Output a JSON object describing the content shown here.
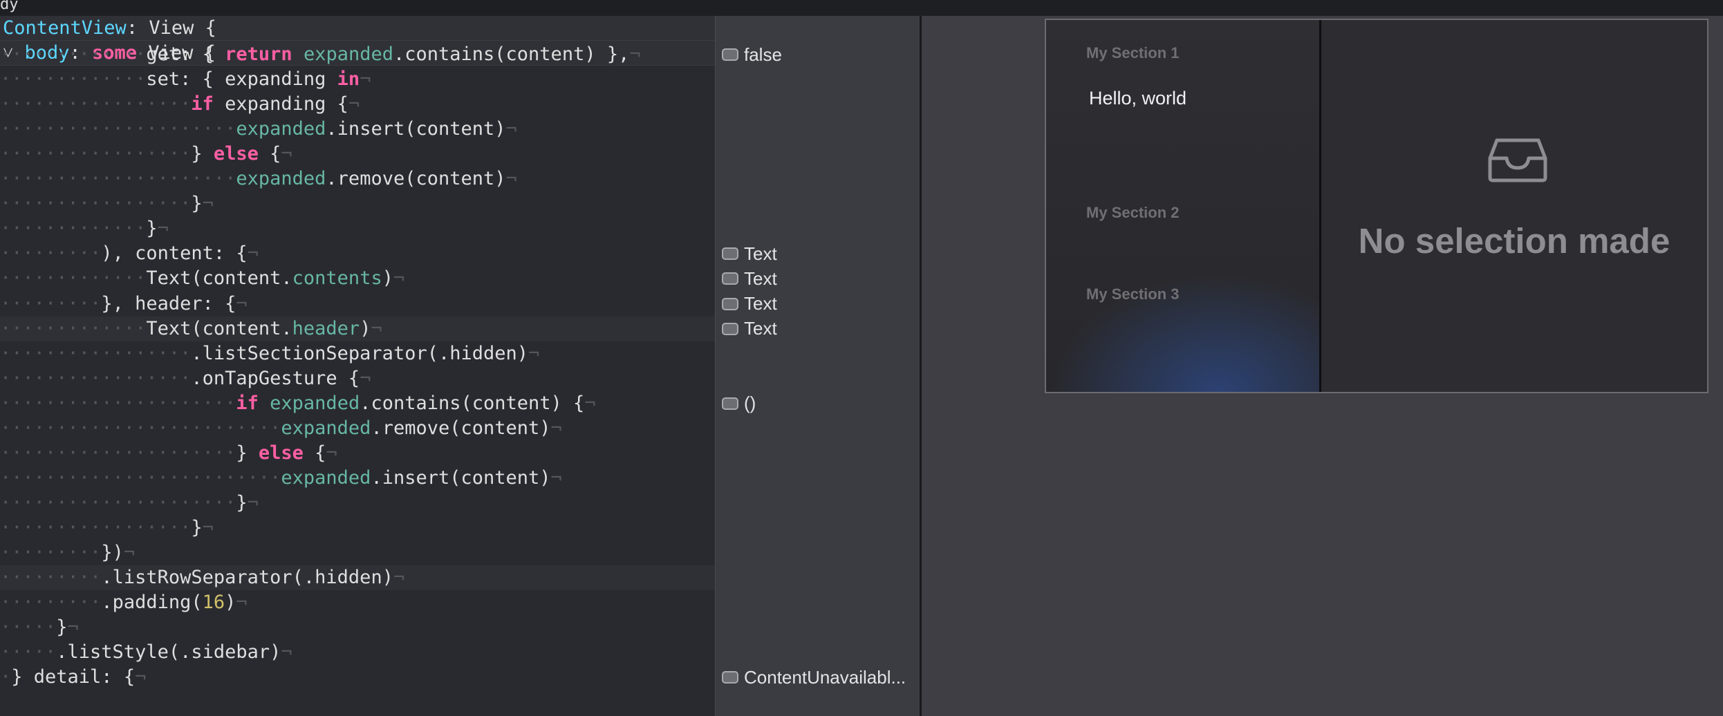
{
  "topbar": {
    "text": "dy"
  },
  "sticky": [
    {
      "t": "tp",
      "v": "ContentView"
    },
    {
      "t": "",
      "v": ": View {"
    }
  ],
  "sticky2": [
    {
      "t": "",
      "v": "˅ "
    },
    {
      "t": "tp",
      "v": "body"
    },
    {
      "t": "",
      "v": ": "
    },
    {
      "t": "kw",
      "v": "some"
    },
    {
      "t": "",
      "v": " View {"
    }
  ],
  "code_lines": [
    [
      {
        "t": "ws",
        "v": "·············"
      },
      {
        "t": "",
        "v": "get: { "
      },
      {
        "t": "kw",
        "v": "return"
      },
      {
        "t": "",
        "v": " "
      },
      {
        "t": "pr",
        "v": "expanded"
      },
      {
        "t": "",
        "v": ".contains(content) },"
      },
      {
        "t": "eol",
        "v": "¬"
      }
    ],
    [
      {
        "t": "ws",
        "v": "·············"
      },
      {
        "t": "",
        "v": "set: { expanding "
      },
      {
        "t": "kw",
        "v": "in"
      },
      {
        "t": "eol",
        "v": "¬"
      }
    ],
    [
      {
        "t": "ws",
        "v": "·················"
      },
      {
        "t": "kw",
        "v": "if"
      },
      {
        "t": "",
        "v": " expanding {"
      },
      {
        "t": "eol",
        "v": "¬"
      }
    ],
    [
      {
        "t": "ws",
        "v": "·····················"
      },
      {
        "t": "pr",
        "v": "expanded"
      },
      {
        "t": "",
        "v": ".insert(content)"
      },
      {
        "t": "eol",
        "v": "¬"
      }
    ],
    [
      {
        "t": "ws",
        "v": "·················"
      },
      {
        "t": "",
        "v": "} "
      },
      {
        "t": "kw",
        "v": "else"
      },
      {
        "t": "",
        "v": " {"
      },
      {
        "t": "eol",
        "v": "¬"
      }
    ],
    [
      {
        "t": "ws",
        "v": "·····················"
      },
      {
        "t": "pr",
        "v": "expanded"
      },
      {
        "t": "",
        "v": ".remove(content)"
      },
      {
        "t": "eol",
        "v": "¬"
      }
    ],
    [
      {
        "t": "ws",
        "v": "·················"
      },
      {
        "t": "",
        "v": "}"
      },
      {
        "t": "eol",
        "v": "¬"
      }
    ],
    [
      {
        "t": "ws",
        "v": "·············"
      },
      {
        "t": "",
        "v": "}"
      },
      {
        "t": "eol",
        "v": "¬"
      }
    ],
    [
      {
        "t": "ws",
        "v": "·········"
      },
      {
        "t": "",
        "v": "), content: {"
      },
      {
        "t": "eol",
        "v": "¬"
      }
    ],
    [
      {
        "t": "ws",
        "v": "·············"
      },
      {
        "t": "",
        "v": "Text(content."
      },
      {
        "t": "pr",
        "v": "contents"
      },
      {
        "t": "",
        "v": ")"
      },
      {
        "t": "eol",
        "v": "¬"
      }
    ],
    [
      {
        "t": "ws",
        "v": "·········"
      },
      {
        "t": "",
        "v": "}, header: {"
      },
      {
        "t": "eol",
        "v": "¬"
      }
    ],
    [
      {
        "t": "ws",
        "v": "·············"
      },
      {
        "t": "",
        "v": "Text(content."
      },
      {
        "t": "pr",
        "v": "header"
      },
      {
        "t": "",
        "v": ")"
      },
      {
        "t": "eol",
        "v": "¬"
      }
    ],
    [
      {
        "t": "ws",
        "v": "·················"
      },
      {
        "t": "",
        "v": ".listSectionSeparator(.hidden)"
      },
      {
        "t": "eol",
        "v": "¬"
      }
    ],
    [
      {
        "t": "ws",
        "v": "·················"
      },
      {
        "t": "",
        "v": ".onTapGesture {"
      },
      {
        "t": "eol",
        "v": "¬"
      }
    ],
    [
      {
        "t": "ws",
        "v": "·····················"
      },
      {
        "t": "kw",
        "v": "if"
      },
      {
        "t": "",
        "v": " "
      },
      {
        "t": "pr",
        "v": "expanded"
      },
      {
        "t": "",
        "v": ".contains(content) {"
      },
      {
        "t": "eol",
        "v": "¬"
      }
    ],
    [
      {
        "t": "ws",
        "v": "·························"
      },
      {
        "t": "pr",
        "v": "expanded"
      },
      {
        "t": "",
        "v": ".remove(content)"
      },
      {
        "t": "eol",
        "v": "¬"
      }
    ],
    [
      {
        "t": "ws",
        "v": "·····················"
      },
      {
        "t": "",
        "v": "} "
      },
      {
        "t": "kw",
        "v": "else"
      },
      {
        "t": "",
        "v": " {"
      },
      {
        "t": "eol",
        "v": "¬"
      }
    ],
    [
      {
        "t": "ws",
        "v": "·························"
      },
      {
        "t": "pr",
        "v": "expanded"
      },
      {
        "t": "",
        "v": ".insert(content)"
      },
      {
        "t": "eol",
        "v": "¬"
      }
    ],
    [
      {
        "t": "ws",
        "v": "·····················"
      },
      {
        "t": "",
        "v": "}"
      },
      {
        "t": "eol",
        "v": "¬"
      }
    ],
    [
      {
        "t": "ws",
        "v": "·················"
      },
      {
        "t": "",
        "v": "}"
      },
      {
        "t": "eol",
        "v": "¬"
      }
    ],
    [
      {
        "t": "ws",
        "v": "·········"
      },
      {
        "t": "",
        "v": "})"
      },
      {
        "t": "eol",
        "v": "¬"
      }
    ],
    [
      {
        "t": "ws",
        "v": "·········"
      },
      {
        "t": "",
        "v": ".listRowSeparator(.hidden)"
      },
      {
        "t": "eol",
        "v": "¬"
      }
    ],
    [
      {
        "t": "ws",
        "v": "·········"
      },
      {
        "t": "",
        "v": ".padding("
      },
      {
        "t": "nm",
        "v": "16"
      },
      {
        "t": "",
        "v": ")"
      },
      {
        "t": "eol",
        "v": "¬"
      }
    ],
    [
      {
        "t": "ws",
        "v": "·····"
      },
      {
        "t": "",
        "v": "}"
      },
      {
        "t": "eol",
        "v": "¬"
      }
    ],
    [
      {
        "t": "ws",
        "v": "·····"
      },
      {
        "t": "",
        "v": ".listStyle(.sidebar)"
      },
      {
        "t": "eol",
        "v": "¬"
      }
    ],
    [
      {
        "t": "ws",
        "v": "·"
      },
      {
        "t": "",
        "v": "} detail: {"
      },
      {
        "t": "eol",
        "v": "¬"
      }
    ]
  ],
  "highlighted_lines": [
    11,
    21
  ],
  "results": [
    {
      "line": 0,
      "label": "false"
    },
    {
      "line": 8,
      "label": "Text"
    },
    {
      "line": 9,
      "label": "Text"
    },
    {
      "line": 10,
      "label": "Text"
    },
    {
      "line": 11,
      "label": "Text"
    },
    {
      "line": 14,
      "label": "()"
    },
    {
      "line": 25,
      "label": "ContentUnavailabl..."
    }
  ],
  "preview": {
    "sections": [
      "My Section 1",
      "My Section 2",
      "My Section 3"
    ],
    "row_text": "Hello, world",
    "empty_title": "No selection made",
    "icon": "tray-icon"
  },
  "colors": {
    "keyword": "#fc5fa3",
    "type": "#5dd8ff",
    "property": "#67b7a4",
    "number": "#d0bf69",
    "editor_bg": "#292a30",
    "canvas_bg": "#3e3e44"
  }
}
